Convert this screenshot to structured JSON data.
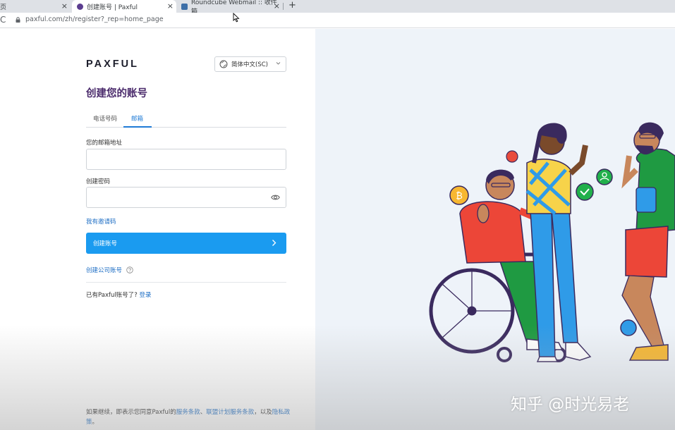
{
  "browser": {
    "tabs": [
      {
        "label": "页",
        "active": false
      },
      {
        "label": "创建账号 | Paxful",
        "active": true
      },
      {
        "label": "Roundcube Webmail :: 收件箱",
        "active": false
      }
    ],
    "new_tab": "+",
    "close_glyph": "×",
    "url": "paxful.com/zh/register?_rep=home_page"
  },
  "header": {
    "logo": "PAXFUL",
    "language": "简体中文(SC)"
  },
  "form": {
    "title": "创建您的账号",
    "tabs": [
      {
        "label": "电话号码",
        "active": false
      },
      {
        "label": "邮箱",
        "active": true
      }
    ],
    "email_label": "您的邮箱地址",
    "password_label": "创建密码",
    "invite_link": "我有邀请码",
    "submit_label": "创建账号",
    "company_link": "创建公司账号",
    "have_account": "已有Paxful账号了?",
    "login_link": "登录"
  },
  "terms": {
    "prefix": "如果继续，即表示您同意Paxful的",
    "service_terms": "服务条款",
    "sep1": "、",
    "affiliate_terms": "联盟计划服务条款",
    "sep2": "，以及",
    "privacy": "隐私政策",
    "suffix": "。"
  },
  "watermark": "知乎 @时光易老",
  "colors": {
    "brand_purple": "#4a2a6b",
    "cta_blue": "#1a9bf0",
    "link_blue": "#1f6fc5",
    "illustration_bg": "#eef3f9"
  }
}
